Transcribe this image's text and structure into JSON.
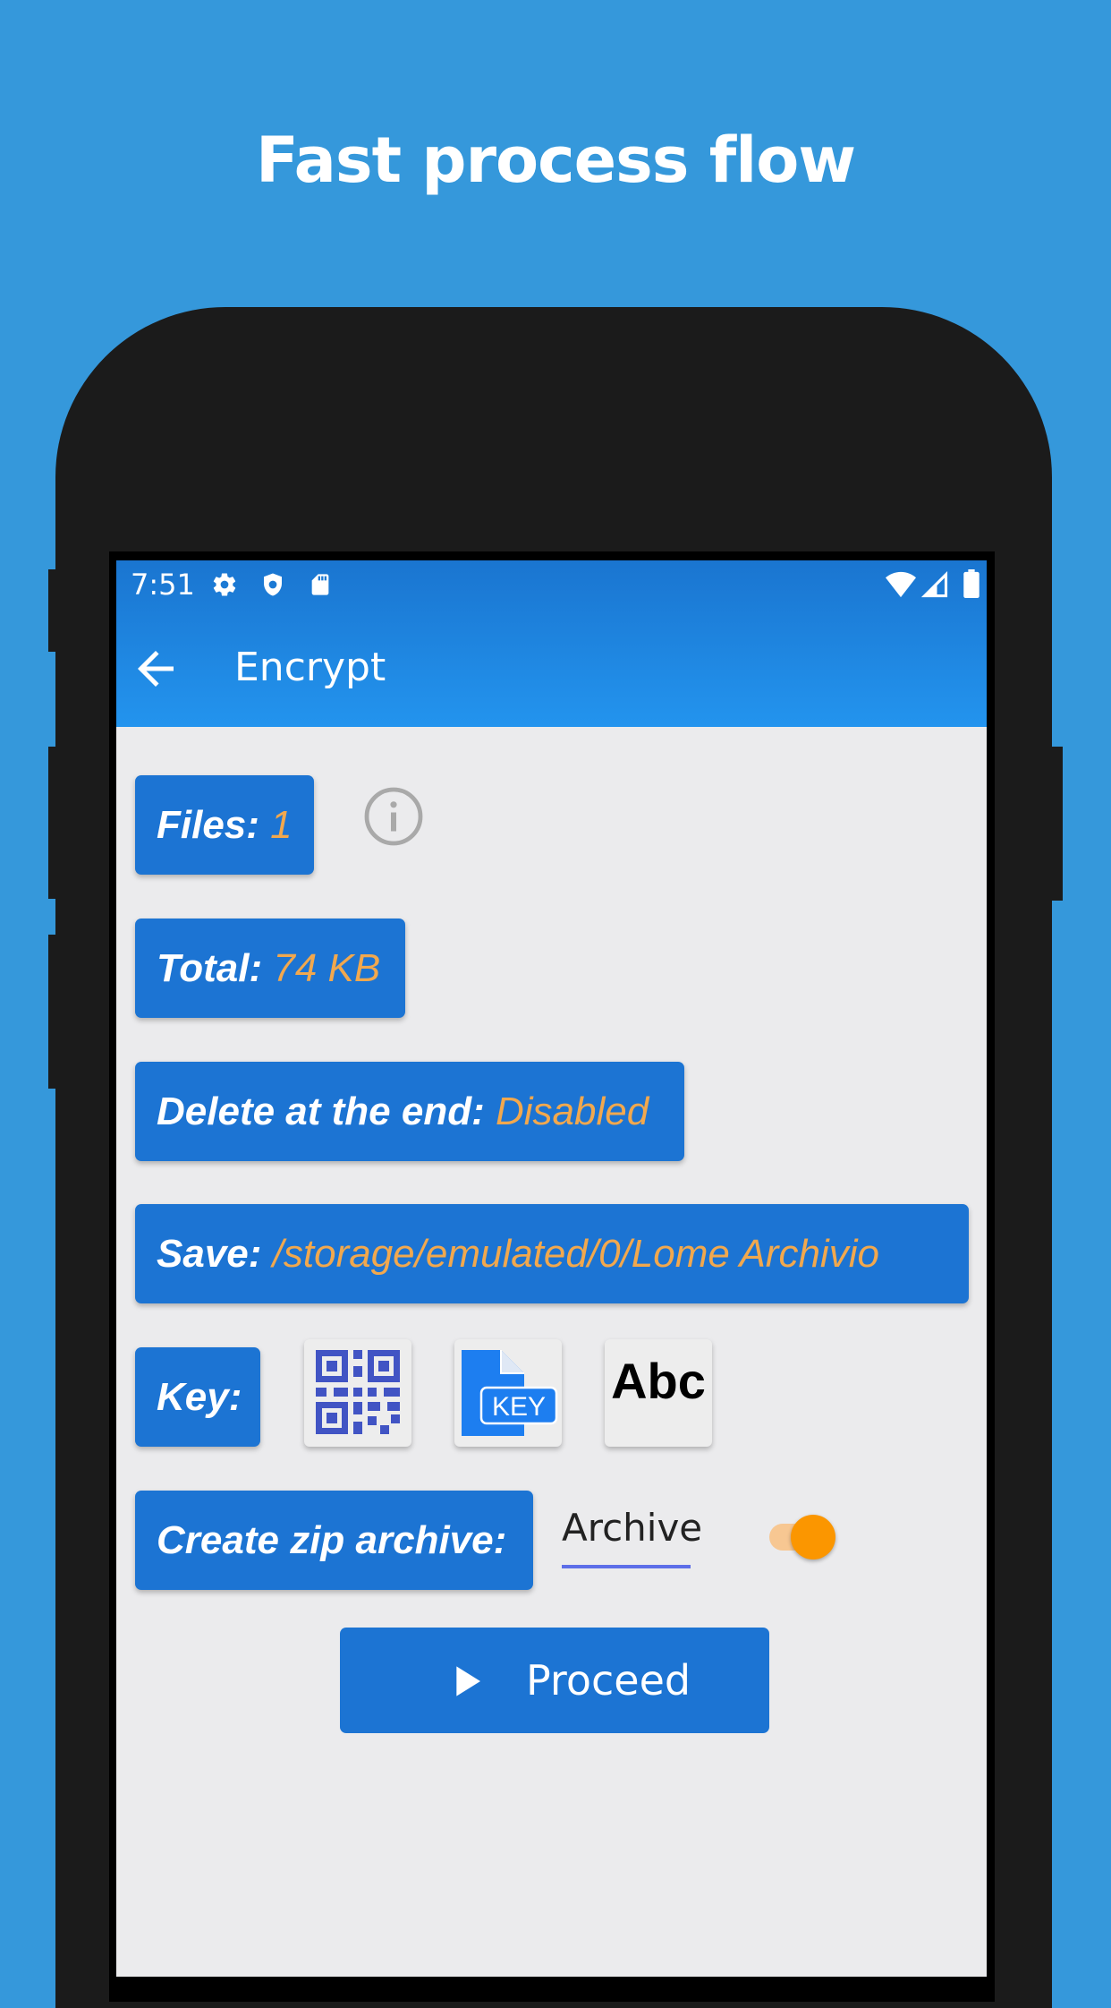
{
  "headline": "Fast process flow",
  "status_bar": {
    "time": "7:51",
    "left_icons": [
      "gear-icon",
      "shield-icon",
      "sd-card-icon"
    ],
    "right_icons": [
      "wifi-icon",
      "signal-icon",
      "battery-icon"
    ]
  },
  "app_bar": {
    "title": "Encrypt",
    "back_icon": "arrow-left-icon"
  },
  "rows": {
    "files": {
      "label": "Files:",
      "value": "1"
    },
    "total": {
      "label": "Total:",
      "value": "74 KB"
    },
    "delete": {
      "label": "Delete at the end:",
      "value": "Disabled"
    },
    "save": {
      "label": "Save:",
      "value": "/storage/emulated/0/Lome Archivio"
    },
    "key": {
      "label": "Key:",
      "options": [
        "qr-code-icon",
        "key-file-icon",
        "Abc"
      ],
      "key_file_text": "KEY"
    },
    "zip": {
      "label": "Create zip archive:",
      "archive_value": "Archive",
      "toggle_on": true
    }
  },
  "proceed": {
    "label": "Proceed",
    "icon": "play-icon"
  },
  "colors": {
    "background": "#3598db",
    "primary": "#1c74d3",
    "accent_value": "#f1a84e",
    "toggle": "#fb9600",
    "screen_bg": "#ebebed"
  }
}
